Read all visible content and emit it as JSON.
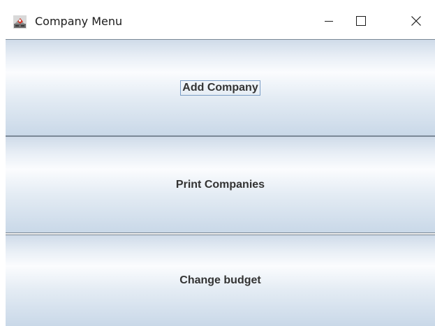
{
  "window": {
    "title": "Company Menu"
  },
  "menu": {
    "add_company_label": "Add Company",
    "print_companies_label": "Print Companies",
    "change_budget_label": "Change budget"
  }
}
